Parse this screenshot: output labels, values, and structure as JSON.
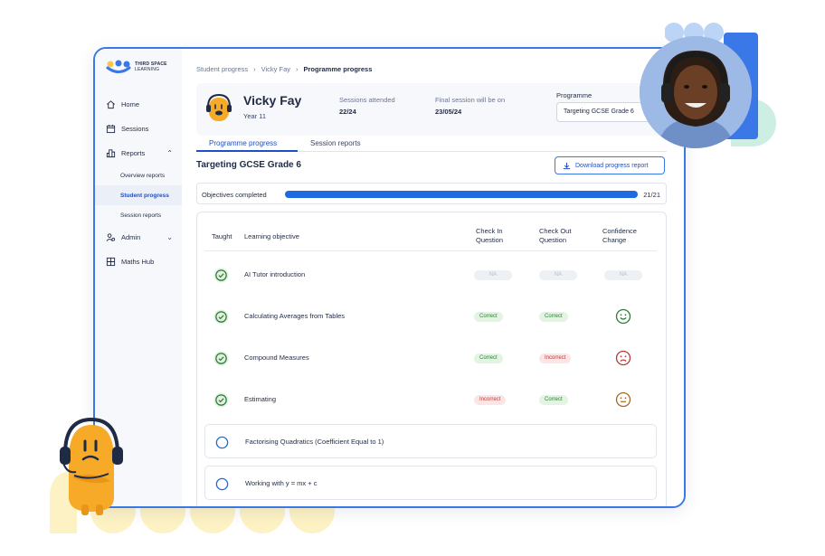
{
  "app": {
    "logo_text_line1": "THIRD SPACE",
    "logo_text_line2": "LEARNING"
  },
  "sidebar": {
    "items": [
      {
        "label": "Home",
        "icon": "home-icon"
      },
      {
        "label": "Sessions",
        "icon": "calendar-icon"
      },
      {
        "label": "Reports",
        "icon": "bar-chart-icon"
      },
      {
        "label": "Admin",
        "icon": "users-icon"
      },
      {
        "label": "Maths Hub",
        "icon": "grid-icon"
      }
    ],
    "sub_items": [
      {
        "label": "Overview reports"
      },
      {
        "label": "Student progress"
      },
      {
        "label": "Session reports"
      }
    ]
  },
  "breadcrumb": {
    "items": [
      "Student progress",
      "Vicky Fay",
      "Programme progress"
    ]
  },
  "student": {
    "name": "Vicky Fay",
    "year": "Year 11",
    "sessions_label": "Sessions attended",
    "sessions_value": "22/24",
    "final_label": "Final session will be on",
    "final_value": "23/05/24",
    "programme_label": "Programme",
    "programme_value": "Targeting GCSE Grade 6"
  },
  "tabs": [
    "Programme progress",
    "Session reports"
  ],
  "section": {
    "title": "Targeting GCSE Grade 6",
    "download_label": "Download progress report"
  },
  "objectives": {
    "label": "Objectives completed",
    "count": "21/21",
    "progress": 1.0
  },
  "table": {
    "headers": {
      "taught": "Taught",
      "objective": "Learning objective",
      "check_in": "Check In Question",
      "check_out": "Check Out Question",
      "confidence": "Confidence Change"
    },
    "rows": [
      {
        "taught": true,
        "objective": "AI Tutor introduction",
        "check_in": "NA",
        "check_out": "NA",
        "confidence": "NA"
      },
      {
        "taught": true,
        "objective": "Calculating Averages from Tables",
        "check_in": "Correct",
        "check_out": "Correct",
        "confidence": "happy"
      },
      {
        "taught": true,
        "objective": "Compound Measures",
        "check_in": "Correct",
        "check_out": "Incorrect",
        "confidence": "sad"
      },
      {
        "taught": true,
        "objective": "Estimating",
        "check_in": "Incorrect",
        "check_out": "Correct",
        "confidence": "neutral"
      },
      {
        "taught": false,
        "objective": "Factorising Quadratics (Coefficient Equal to 1)"
      },
      {
        "taught": false,
        "objective": "Working with y = mx + c"
      }
    ]
  },
  "colors": {
    "accent": "#1f4fc4",
    "border": "#3b78e7",
    "correct": "#2f7a37",
    "incorrect": "#b83a3a"
  }
}
